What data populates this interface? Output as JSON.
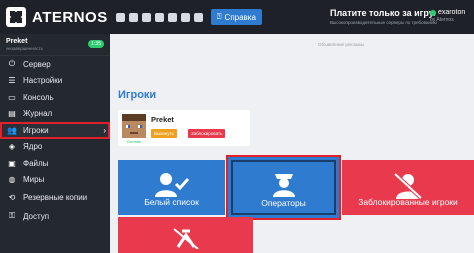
{
  "header": {
    "brand": "ATERNOS",
    "social_icons": [
      "youtube-icon",
      "twitter-icon",
      "facebook-icon",
      "instagram-icon",
      "discord-icon",
      "reddit-icon",
      "github-icon"
    ],
    "help_label": "Справка",
    "promo_title": "Платите только за игру.",
    "promo_sub": "Высокопроизводительные серверы по требованию",
    "partner": "exaroton",
    "partner_sub": "by Aternos"
  },
  "sidebar": {
    "user_name": "Preket",
    "user_sub": "незавершенность",
    "badge": "1:35",
    "items": [
      {
        "label": "Сервер",
        "icon": "power-icon"
      },
      {
        "label": "Настройки",
        "icon": "settings-icon"
      },
      {
        "label": "Консоль",
        "icon": "terminal-icon"
      },
      {
        "label": "Журнал",
        "icon": "log-icon"
      },
      {
        "label": "Игроки",
        "icon": "players-icon"
      },
      {
        "label": "Ядро",
        "icon": "cube-icon"
      },
      {
        "label": "Файлы",
        "icon": "folder-icon"
      },
      {
        "label": "Миры",
        "icon": "globe-icon"
      },
      {
        "label": "Резервные копии",
        "icon": "backup-icon"
      },
      {
        "label": "Доступ",
        "icon": "access-icon"
      }
    ]
  },
  "main": {
    "ad_label": "Объявление рекламы",
    "title": "Игроки",
    "player": {
      "name": "Preket",
      "status": "Онлайн",
      "kick_label": "Выкинуть",
      "ban_label": "Заблокировать"
    },
    "tiles": [
      {
        "label": "Белый список",
        "icon": "user-check-icon"
      },
      {
        "label": "Операторы",
        "icon": "operator-icon"
      },
      {
        "label": "Заблокированные игроки",
        "icon": "user-slash-icon"
      },
      {
        "label": "",
        "icon": "ban-hammer-icon"
      }
    ]
  },
  "colors": {
    "topbar": "#1e2228",
    "sidebar": "#24282f",
    "accent_blue": "#2e7bcf",
    "accent_red": "#e8394d",
    "highlight": "#e0202b"
  }
}
